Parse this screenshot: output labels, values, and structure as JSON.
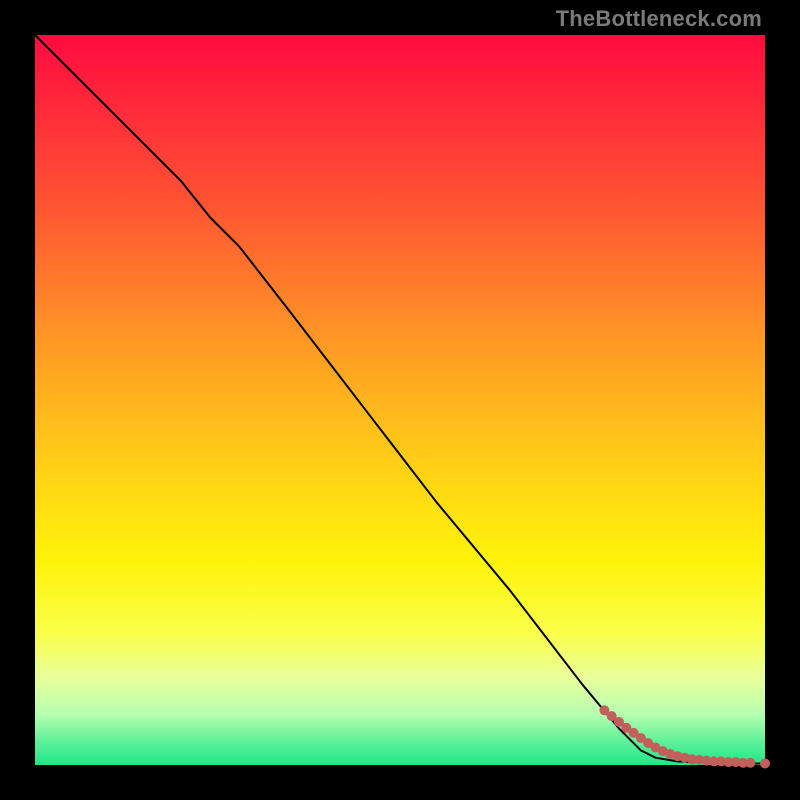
{
  "attribution": "TheBottleneck.com",
  "colors": {
    "background": "#000000",
    "curve": "#000000",
    "marker": "#c1605b",
    "gradient_top": "#ff0b3f",
    "gradient_bottom": "#1ee886"
  },
  "chart_data": {
    "type": "line",
    "title": "",
    "xlabel": "",
    "ylabel": "",
    "xlim": [
      0,
      100
    ],
    "ylim": [
      0,
      100
    ],
    "grid": false,
    "legend": false,
    "series": [
      {
        "name": "bottleneck-curve",
        "x": [
          0,
          5,
          10,
          15,
          20,
          24,
          28,
          35,
          45,
          55,
          65,
          75,
          80,
          83,
          85,
          88,
          90,
          92,
          94,
          96,
          98,
          100
        ],
        "y": [
          100,
          95,
          90,
          85,
          80,
          75,
          71,
          62,
          49,
          36,
          24,
          11,
          5,
          2,
          1,
          0.5,
          0.4,
          0.3,
          0.3,
          0.3,
          0.2,
          0.2
        ]
      }
    ],
    "markers": {
      "name": "bottleneck-points",
      "x": [
        78,
        79,
        80,
        81,
        82,
        83,
        84,
        85,
        86,
        87,
        88,
        89,
        90,
        91,
        92,
        93,
        94,
        95,
        96,
        97,
        98,
        100
      ],
      "y": [
        7.5,
        6.7,
        5.9,
        5.1,
        4.4,
        3.7,
        3.0,
        2.4,
        1.9,
        1.5,
        1.2,
        1.0,
        0.8,
        0.7,
        0.6,
        0.5,
        0.5,
        0.4,
        0.4,
        0.3,
        0.3,
        0.2
      ]
    }
  }
}
